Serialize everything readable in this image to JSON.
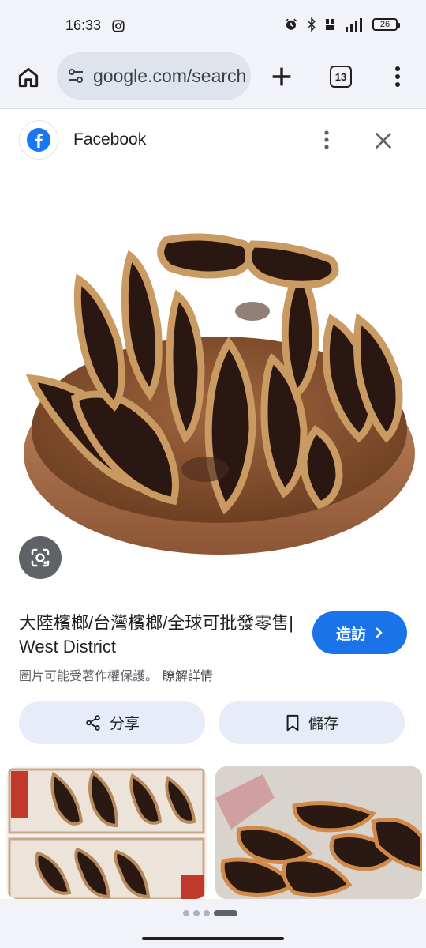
{
  "status": {
    "time": "16:33",
    "battery": "26"
  },
  "browser": {
    "url": "google.com/search",
    "tab_count": "13"
  },
  "source": {
    "name": "Facebook"
  },
  "result": {
    "title": "大陸檳榔/台灣檳榔/全球可批發零售| West District",
    "visit_label": "造訪",
    "copyright_notice": "圖片可能受著作權保護。",
    "learn_more": "瞭解詳情",
    "share_label": "分享",
    "save_label": "儲存"
  },
  "colors": {
    "accent": "#1a73e8",
    "facebook": "#1877f2",
    "chip_bg": "#e7edf8"
  },
  "icons": [
    "instagram-icon",
    "alarm-icon",
    "bluetooth-icon",
    "signal-icon",
    "battery-icon",
    "home-icon",
    "tune-icon",
    "plus-icon",
    "tabs-icon",
    "more-vert-icon",
    "facebook-icon",
    "close-icon",
    "lens-icon",
    "chevron-right-icon",
    "share-icon",
    "bookmark-icon"
  ]
}
